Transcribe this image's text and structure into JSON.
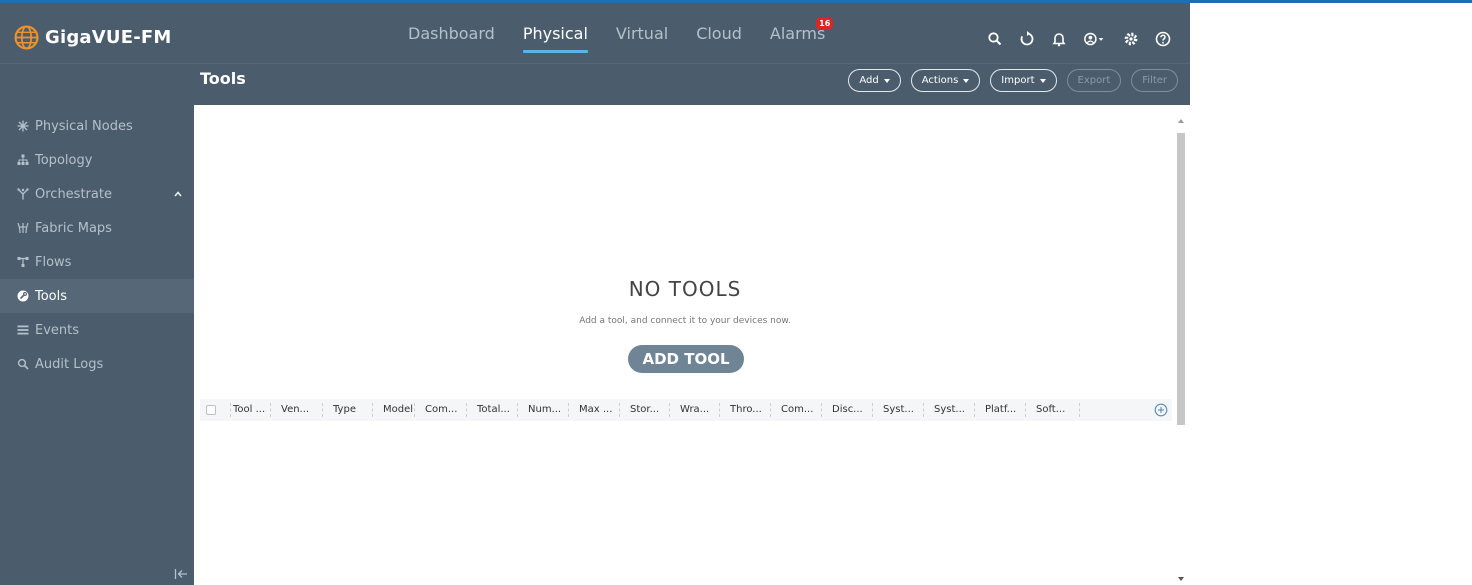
{
  "brand": {
    "name": "GigaVUE-FM",
    "logo_icon": "globe-logo-icon",
    "logo_color": "#f0922b"
  },
  "nav": {
    "items": [
      {
        "label": "Dashboard",
        "active": false
      },
      {
        "label": "Physical",
        "active": true
      },
      {
        "label": "Virtual",
        "active": false
      },
      {
        "label": "Cloud",
        "active": false
      },
      {
        "label": "Alarms",
        "active": false,
        "badge": "16"
      }
    ]
  },
  "top_icons": [
    "search-icon",
    "refresh-icon",
    "bell-icon",
    "user-account-icon",
    "settings-gear-icon",
    "help-icon"
  ],
  "header": {
    "title": "Tools",
    "actions": [
      {
        "label": "Add",
        "dropdown": true,
        "enabled": true
      },
      {
        "label": "Actions",
        "dropdown": true,
        "enabled": true
      },
      {
        "label": "Import",
        "dropdown": true,
        "enabled": true
      },
      {
        "label": "Export",
        "dropdown": false,
        "enabled": false
      },
      {
        "label": "Filter",
        "dropdown": false,
        "enabled": false
      }
    ]
  },
  "sidebar": {
    "items": [
      {
        "label": "Physical Nodes",
        "icon": "nodes-icon",
        "active": false
      },
      {
        "label": "Topology",
        "icon": "topology-icon",
        "active": false
      },
      {
        "label": "Orchestrate",
        "icon": "orchestrate-icon",
        "active": false,
        "expanded": true
      },
      {
        "label": "Fabric Maps",
        "icon": "fabric-maps-icon",
        "active": false
      },
      {
        "label": "Flows",
        "icon": "flows-icon",
        "active": false
      },
      {
        "label": "Tools",
        "icon": "tools-icon",
        "active": true
      },
      {
        "label": "Events",
        "icon": "events-icon",
        "active": false
      },
      {
        "label": "Audit Logs",
        "icon": "search-icon",
        "active": false
      }
    ]
  },
  "empty_state": {
    "title": "NO TOOLS",
    "subtitle": "Add a tool, and connect it to your devices now.",
    "button": "ADD TOOL"
  },
  "table": {
    "columns": [
      "Tool ...",
      "Ven...",
      "Type",
      "Model",
      "Com...",
      "Total...",
      "Num...",
      "Max ...",
      "Stor...",
      "Wra...",
      "Thro...",
      "Com...",
      "Disc...",
      "Syst...",
      "Syst...",
      "Platf...",
      "Soft..."
    ]
  },
  "colors": {
    "nav_bg": "#4b5d6c",
    "active_underline": "#5ab4e8",
    "alarm_badge": "#e02424",
    "add_tool_button": "#6f8494",
    "top_accent": "#1f6fb2"
  }
}
